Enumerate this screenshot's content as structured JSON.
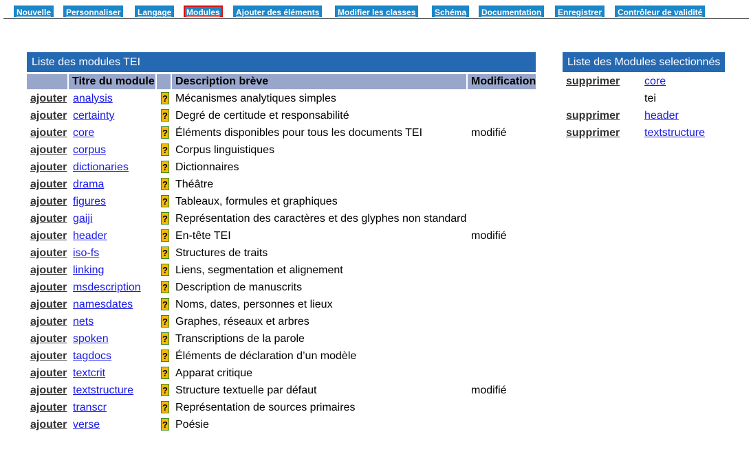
{
  "nav": {
    "tabs": [
      {
        "label": "Nouvelle"
      },
      {
        "label": "Personnaliser"
      },
      {
        "label": "Langage"
      },
      {
        "label": "Modules"
      },
      {
        "label": "Ajouter des éléments"
      },
      {
        "label": "Modifier les classes"
      },
      {
        "label": "Schéma"
      },
      {
        "label": "Documentation"
      },
      {
        "label": "Enregistrer"
      },
      {
        "label": "Contrôleur de validité"
      }
    ],
    "active": "Modules"
  },
  "left": {
    "title": "Liste des modules TEI",
    "headers": {
      "title": "Titre du module",
      "description": "Description brève",
      "modification": "Modification"
    },
    "action_label": "ajouter",
    "help_label": "?",
    "rows": [
      {
        "module": "analysis",
        "description": "Mécanismes analytiques simples",
        "modification": ""
      },
      {
        "module": "certainty",
        "description": "Degré de certitude et responsabilité",
        "modification": ""
      },
      {
        "module": "core",
        "description": "Éléments disponibles pour tous les documents TEI",
        "modification": "modifié"
      },
      {
        "module": "corpus",
        "description": "Corpus linguistiques",
        "modification": ""
      },
      {
        "module": "dictionaries",
        "description": "Dictionnaires",
        "modification": ""
      },
      {
        "module": "drama",
        "description": "Théâtre",
        "modification": ""
      },
      {
        "module": "figures",
        "description": "Tableaux, formules et graphiques",
        "modification": ""
      },
      {
        "module": "gaiji",
        "description": "Représentation des caractères et des glyphes non standard",
        "modification": ""
      },
      {
        "module": "header",
        "description": "En-tête TEI",
        "modification": "modifié"
      },
      {
        "module": "iso-fs",
        "description": "Structures de traits",
        "modification": ""
      },
      {
        "module": "linking",
        "description": "Liens, segmentation et alignement",
        "modification": ""
      },
      {
        "module": "msdescription",
        "description": "Description de manuscrits",
        "modification": ""
      },
      {
        "module": "namesdates",
        "description": "Noms, dates, personnes et lieux",
        "modification": ""
      },
      {
        "module": "nets",
        "description": "Graphes, réseaux et arbres",
        "modification": ""
      },
      {
        "module": "spoken",
        "description": "Transcriptions de la parole",
        "modification": ""
      },
      {
        "module": "tagdocs",
        "description": "Éléments de déclaration d’un modèle",
        "modification": ""
      },
      {
        "module": "textcrit",
        "description": "Apparat critique",
        "modification": ""
      },
      {
        "module": "textstructure",
        "description": "Structure textuelle par défaut",
        "modification": "modifié"
      },
      {
        "module": "transcr",
        "description": "Représentation de sources primaires",
        "modification": ""
      },
      {
        "module": "verse",
        "description": "Poésie",
        "modification": ""
      }
    ]
  },
  "right": {
    "title": "Liste des Modules selectionnés",
    "action_label": "supprimer",
    "rows": [
      {
        "module": "core",
        "removable": true
      },
      {
        "module": "tei",
        "removable": false
      },
      {
        "module": "header",
        "removable": true
      },
      {
        "module": "textstructure",
        "removable": true
      }
    ]
  },
  "colors": {
    "nav_tab": "#1b87c9",
    "active_border": "#dd1111",
    "panel_title": "#2569b3",
    "column_header": "#99a6cc",
    "link": "#1a1ae6",
    "help_icon": "#f4ba0b"
  }
}
